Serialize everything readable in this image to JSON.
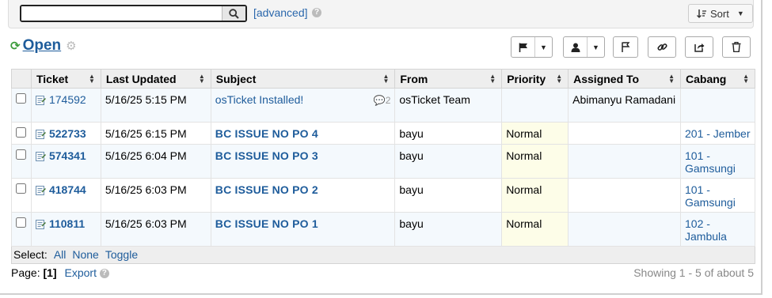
{
  "search": {
    "value": "",
    "advanced_label": "[advanced]",
    "help": "?"
  },
  "sort": {
    "label": "Sort"
  },
  "queue": {
    "title": "Open"
  },
  "columns": [
    "Ticket",
    "Last Updated",
    "Subject",
    "From",
    "Priority",
    "Assigned To",
    "Cabang"
  ],
  "rows": [
    {
      "ticket": "174592",
      "updated": "5/16/25 5:15 PM",
      "subject": "osTicket Installed!",
      "thread_count": "2",
      "from": "osTicket Team",
      "priority": "",
      "assigned": "Abimanyu Ramadani",
      "cabang": ""
    },
    {
      "ticket": "522733",
      "updated": "5/16/25 6:15 PM",
      "subject": "BC ISSUE NO PO 4",
      "thread_count": "",
      "from": "bayu",
      "priority": "Normal",
      "assigned": "",
      "cabang": "201 - Jember"
    },
    {
      "ticket": "574341",
      "updated": "5/16/25 6:04 PM",
      "subject": "BC ISSUE NO PO 3",
      "thread_count": "",
      "from": "bayu",
      "priority": "Normal",
      "assigned": "",
      "cabang": "101 - Gamsungi"
    },
    {
      "ticket": "418744",
      "updated": "5/16/25 6:03 PM",
      "subject": "BC ISSUE NO PO 2",
      "thread_count": "",
      "from": "bayu",
      "priority": "Normal",
      "assigned": "",
      "cabang": "101 - Gamsungi"
    },
    {
      "ticket": "110811",
      "updated": "5/16/25 6:03 PM",
      "subject": "BC ISSUE NO PO 1",
      "thread_count": "",
      "from": "bayu",
      "priority": "Normal",
      "assigned": "",
      "cabang": "102 - Jambula"
    }
  ],
  "select": {
    "label": "Select:",
    "all": "All",
    "none": "None",
    "toggle": "Toggle"
  },
  "footer": {
    "page_label": "Page:",
    "page": "[1]",
    "export": "Export",
    "showing": "Showing 1 - 5 of about 5"
  },
  "colors": {
    "link": "#1e5c9b",
    "refresh": "#3a9b3a",
    "priority_bg": "#fdfde8",
    "row_alt": "#f4f9fd"
  }
}
